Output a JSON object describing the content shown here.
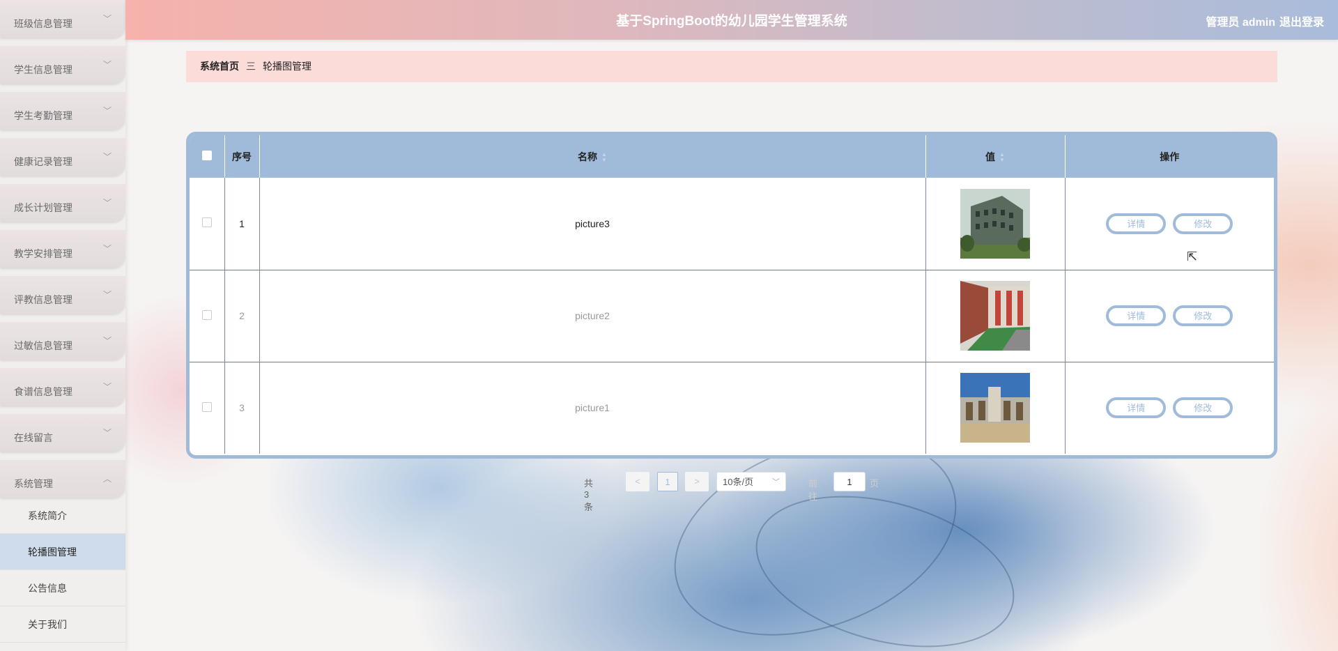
{
  "app": {
    "title": "基于SpringBoot的幼儿园学生管理系统",
    "user_label": "管理员 admin",
    "logout_label": "退出登录"
  },
  "sidebar": {
    "items": [
      {
        "label": "班级信息管理",
        "expanded": false
      },
      {
        "label": "学生信息管理",
        "expanded": false
      },
      {
        "label": "学生考勤管理",
        "expanded": false
      },
      {
        "label": "健康记录管理",
        "expanded": false
      },
      {
        "label": "成长计划管理",
        "expanded": false
      },
      {
        "label": "教学安排管理",
        "expanded": false
      },
      {
        "label": "评教信息管理",
        "expanded": false
      },
      {
        "label": "过敏信息管理",
        "expanded": false
      },
      {
        "label": "食谱信息管理",
        "expanded": false
      },
      {
        "label": "在线留言",
        "expanded": false
      },
      {
        "label": "系统管理",
        "expanded": true
      }
    ],
    "sub_items": [
      {
        "label": "系统简介",
        "active": false
      },
      {
        "label": "轮播图管理",
        "active": true
      },
      {
        "label": "公告信息",
        "active": false
      },
      {
        "label": "关于我们",
        "active": false
      }
    ]
  },
  "breadcrumb": {
    "home": "系统首页",
    "separator": "三",
    "current": "轮播图管理"
  },
  "table": {
    "headers": {
      "index": "序号",
      "name": "名称",
      "value": "值",
      "actions": "操作"
    },
    "rows": [
      {
        "index": "1",
        "name": "picture3",
        "image": "building-green"
      },
      {
        "index": "2",
        "name": "picture2",
        "image": "building-red"
      },
      {
        "index": "3",
        "name": "picture1",
        "image": "building-sky"
      }
    ],
    "detail_label": "详情",
    "edit_label": "修改"
  },
  "pagination": {
    "total_text": "共 3 条",
    "prev": "<",
    "current_page": "1",
    "next": ">",
    "page_size": "10条/页",
    "goto_prefix": "前往",
    "goto_value": "1",
    "goto_suffix": "页"
  },
  "colors": {
    "accent": "#9fbbd9",
    "breadcrumb_bg": "#fcdcd9"
  }
}
